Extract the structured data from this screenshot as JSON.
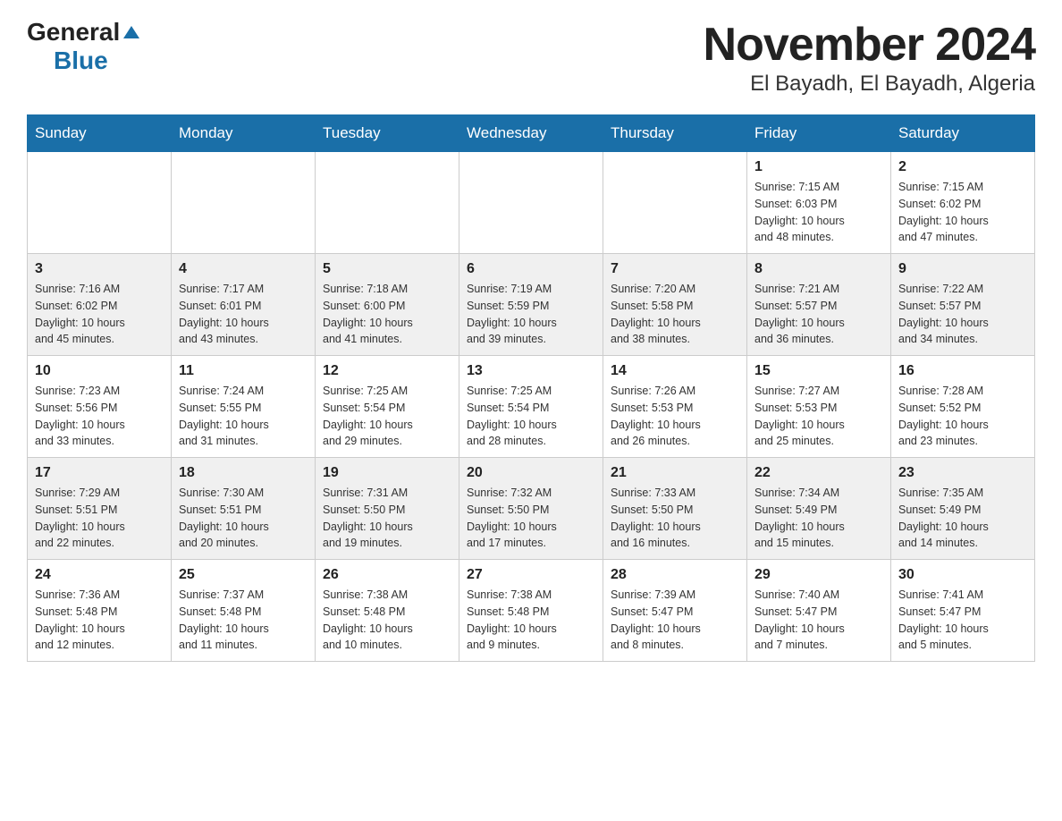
{
  "header": {
    "logo_general": "General",
    "logo_blue": "Blue",
    "title": "November 2024",
    "subtitle": "El Bayadh, El Bayadh, Algeria"
  },
  "days_of_week": [
    "Sunday",
    "Monday",
    "Tuesday",
    "Wednesday",
    "Thursday",
    "Friday",
    "Saturday"
  ],
  "weeks": [
    {
      "days": [
        {
          "num": "",
          "info": ""
        },
        {
          "num": "",
          "info": ""
        },
        {
          "num": "",
          "info": ""
        },
        {
          "num": "",
          "info": ""
        },
        {
          "num": "",
          "info": ""
        },
        {
          "num": "1",
          "info": "Sunrise: 7:15 AM\nSunset: 6:03 PM\nDaylight: 10 hours\nand 48 minutes."
        },
        {
          "num": "2",
          "info": "Sunrise: 7:15 AM\nSunset: 6:02 PM\nDaylight: 10 hours\nand 47 minutes."
        }
      ]
    },
    {
      "days": [
        {
          "num": "3",
          "info": "Sunrise: 7:16 AM\nSunset: 6:02 PM\nDaylight: 10 hours\nand 45 minutes."
        },
        {
          "num": "4",
          "info": "Sunrise: 7:17 AM\nSunset: 6:01 PM\nDaylight: 10 hours\nand 43 minutes."
        },
        {
          "num": "5",
          "info": "Sunrise: 7:18 AM\nSunset: 6:00 PM\nDaylight: 10 hours\nand 41 minutes."
        },
        {
          "num": "6",
          "info": "Sunrise: 7:19 AM\nSunset: 5:59 PM\nDaylight: 10 hours\nand 39 minutes."
        },
        {
          "num": "7",
          "info": "Sunrise: 7:20 AM\nSunset: 5:58 PM\nDaylight: 10 hours\nand 38 minutes."
        },
        {
          "num": "8",
          "info": "Sunrise: 7:21 AM\nSunset: 5:57 PM\nDaylight: 10 hours\nand 36 minutes."
        },
        {
          "num": "9",
          "info": "Sunrise: 7:22 AM\nSunset: 5:57 PM\nDaylight: 10 hours\nand 34 minutes."
        }
      ]
    },
    {
      "days": [
        {
          "num": "10",
          "info": "Sunrise: 7:23 AM\nSunset: 5:56 PM\nDaylight: 10 hours\nand 33 minutes."
        },
        {
          "num": "11",
          "info": "Sunrise: 7:24 AM\nSunset: 5:55 PM\nDaylight: 10 hours\nand 31 minutes."
        },
        {
          "num": "12",
          "info": "Sunrise: 7:25 AM\nSunset: 5:54 PM\nDaylight: 10 hours\nand 29 minutes."
        },
        {
          "num": "13",
          "info": "Sunrise: 7:25 AM\nSunset: 5:54 PM\nDaylight: 10 hours\nand 28 minutes."
        },
        {
          "num": "14",
          "info": "Sunrise: 7:26 AM\nSunset: 5:53 PM\nDaylight: 10 hours\nand 26 minutes."
        },
        {
          "num": "15",
          "info": "Sunrise: 7:27 AM\nSunset: 5:53 PM\nDaylight: 10 hours\nand 25 minutes."
        },
        {
          "num": "16",
          "info": "Sunrise: 7:28 AM\nSunset: 5:52 PM\nDaylight: 10 hours\nand 23 minutes."
        }
      ]
    },
    {
      "days": [
        {
          "num": "17",
          "info": "Sunrise: 7:29 AM\nSunset: 5:51 PM\nDaylight: 10 hours\nand 22 minutes."
        },
        {
          "num": "18",
          "info": "Sunrise: 7:30 AM\nSunset: 5:51 PM\nDaylight: 10 hours\nand 20 minutes."
        },
        {
          "num": "19",
          "info": "Sunrise: 7:31 AM\nSunset: 5:50 PM\nDaylight: 10 hours\nand 19 minutes."
        },
        {
          "num": "20",
          "info": "Sunrise: 7:32 AM\nSunset: 5:50 PM\nDaylight: 10 hours\nand 17 minutes."
        },
        {
          "num": "21",
          "info": "Sunrise: 7:33 AM\nSunset: 5:50 PM\nDaylight: 10 hours\nand 16 minutes."
        },
        {
          "num": "22",
          "info": "Sunrise: 7:34 AM\nSunset: 5:49 PM\nDaylight: 10 hours\nand 15 minutes."
        },
        {
          "num": "23",
          "info": "Sunrise: 7:35 AM\nSunset: 5:49 PM\nDaylight: 10 hours\nand 14 minutes."
        }
      ]
    },
    {
      "days": [
        {
          "num": "24",
          "info": "Sunrise: 7:36 AM\nSunset: 5:48 PM\nDaylight: 10 hours\nand 12 minutes."
        },
        {
          "num": "25",
          "info": "Sunrise: 7:37 AM\nSunset: 5:48 PM\nDaylight: 10 hours\nand 11 minutes."
        },
        {
          "num": "26",
          "info": "Sunrise: 7:38 AM\nSunset: 5:48 PM\nDaylight: 10 hours\nand 10 minutes."
        },
        {
          "num": "27",
          "info": "Sunrise: 7:38 AM\nSunset: 5:48 PM\nDaylight: 10 hours\nand 9 minutes."
        },
        {
          "num": "28",
          "info": "Sunrise: 7:39 AM\nSunset: 5:47 PM\nDaylight: 10 hours\nand 8 minutes."
        },
        {
          "num": "29",
          "info": "Sunrise: 7:40 AM\nSunset: 5:47 PM\nDaylight: 10 hours\nand 7 minutes."
        },
        {
          "num": "30",
          "info": "Sunrise: 7:41 AM\nSunset: 5:47 PM\nDaylight: 10 hours\nand 5 minutes."
        }
      ]
    }
  ]
}
